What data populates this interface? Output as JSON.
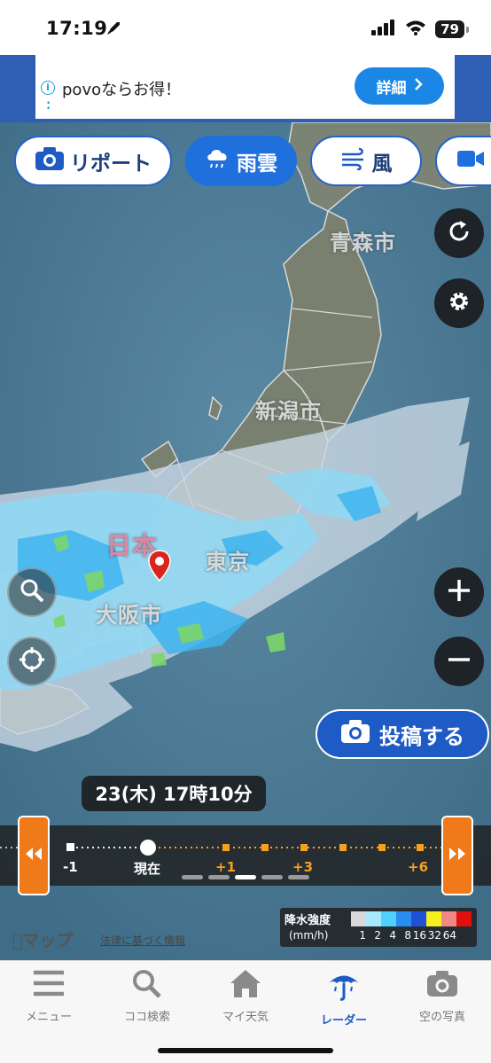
{
  "status_bar": {
    "time": "17:19",
    "battery": "79"
  },
  "ad": {
    "text": "povoならお得！",
    "button_label": "詳細"
  },
  "layer_tabs": [
    {
      "label": "リポート",
      "icon": "camera-icon",
      "active": false
    },
    {
      "label": "雨雲",
      "icon": "rain-cloud-icon",
      "active": true
    },
    {
      "label": "風",
      "icon": "wind-icon",
      "active": false
    }
  ],
  "map_labels": {
    "aomori": "青森市",
    "niigata": "新潟市",
    "tokyo": "東京",
    "osaka": "大阪市",
    "japan": "日本"
  },
  "post_button_label": "投稿する",
  "current_time_label": "23(木) 17時10分",
  "timeline": {
    "labels": [
      {
        "text": "-1",
        "highlight": false
      },
      {
        "text": "現在",
        "highlight": false
      },
      {
        "text": "+1",
        "highlight": true
      },
      {
        "text": "+3",
        "highlight": true
      },
      {
        "text": "+6",
        "highlight": true
      }
    ],
    "pages": 5,
    "active_page": 3
  },
  "legend": {
    "title": "降水強度",
    "unit": "(mm/h)",
    "values": [
      "1",
      "2",
      "4",
      "8",
      "16",
      "32",
      "64"
    ],
    "colors": [
      "#d8d8d8",
      "#a8e8ff",
      "#4fd0ff",
      "#2a8cf0",
      "#2050d8",
      "#f5f020",
      "#f08888",
      "#e01010"
    ]
  },
  "attribution": {
    "maps": "マップ",
    "legal": "法律に基づく情報"
  },
  "bottom_nav": [
    {
      "label": "メニュー",
      "icon": "menu-icon",
      "active": false
    },
    {
      "label": "ココ検索",
      "icon": "search-icon",
      "active": false
    },
    {
      "label": "マイ天気",
      "icon": "home-icon",
      "active": false
    },
    {
      "label": "レーダー",
      "icon": "umbrella-icon",
      "active": true
    },
    {
      "label": "空の写真",
      "icon": "camera-icon",
      "active": false
    }
  ]
}
